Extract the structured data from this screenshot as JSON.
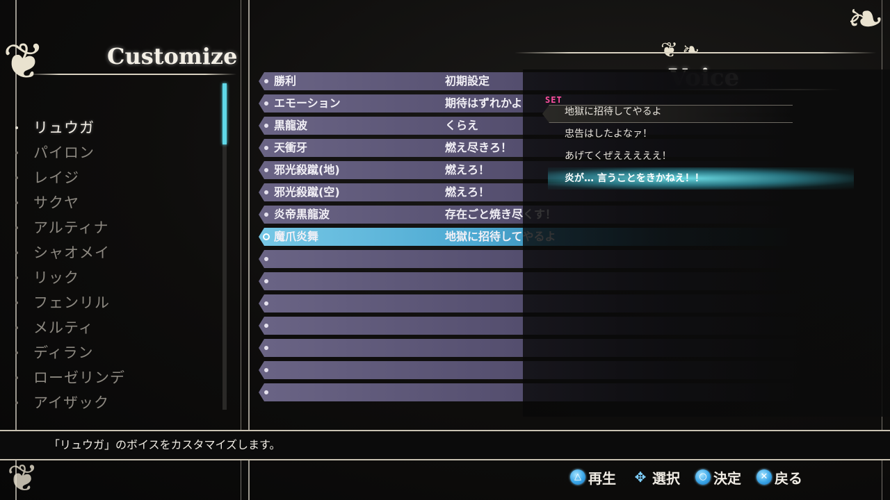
{
  "header": {
    "customize_title": "Customize",
    "voice_title": "Voice"
  },
  "characters": [
    {
      "label": "リュウガ",
      "selected": true
    },
    {
      "label": "パイロン",
      "selected": false
    },
    {
      "label": "レイジ",
      "selected": false
    },
    {
      "label": "サクヤ",
      "selected": false
    },
    {
      "label": "アルティナ",
      "selected": false
    },
    {
      "label": "シャオメイ",
      "selected": false
    },
    {
      "label": "リック",
      "selected": false
    },
    {
      "label": "フェンリル",
      "selected": false
    },
    {
      "label": "メルティ",
      "selected": false
    },
    {
      "label": "ディラン",
      "selected": false
    },
    {
      "label": "ローゼリンデ",
      "selected": false
    },
    {
      "label": "アイザック",
      "selected": false
    }
  ],
  "voice_slots": [
    {
      "name": "勝利",
      "value": "初期設定"
    },
    {
      "name": "エモーション",
      "value": "期待はずれかよ"
    },
    {
      "name": "黒龍波",
      "value": "くらえ"
    },
    {
      "name": "天衝牙",
      "value": "燃え尽きろ！"
    },
    {
      "name": "邪光殺蹴(地)",
      "value": "燃えろ！"
    },
    {
      "name": "邪光殺蹴(空)",
      "value": "燃えろ！"
    },
    {
      "name": "炎帝黒龍波",
      "value": "存在ごと焼き尽くす！"
    },
    {
      "name": "魔爪炎舞",
      "value": "地獄に招待してやるよ"
    },
    {
      "name": "",
      "value": ""
    },
    {
      "name": "",
      "value": ""
    },
    {
      "name": "",
      "value": ""
    },
    {
      "name": "",
      "value": ""
    },
    {
      "name": "",
      "value": ""
    },
    {
      "name": "",
      "value": ""
    },
    {
      "name": "",
      "value": ""
    }
  ],
  "active_slot_index": 7,
  "voice_panel": {
    "set_badge": "SET",
    "options": [
      "地獄に招待してやるよ",
      "忠告はしたよなァ！",
      "あげてくぜえええええ！",
      "炎が… 言うことをきかねえ！！"
    ]
  },
  "description": "「リュウガ」のボイスをカスタマイズします。",
  "footer": {
    "play_label": "再生",
    "select_label": "選択",
    "confirm_label": "決定",
    "back_label": "戻る",
    "play_icon": "triangle-button-icon",
    "select_icon": "dpad-icon",
    "confirm_icon": "circle-button-icon",
    "back_icon": "cross-button-icon"
  },
  "colors": {
    "accent_blue": "#4da9d2",
    "set_pink": "#ff4fa0",
    "row_purple": "#6a6485"
  }
}
